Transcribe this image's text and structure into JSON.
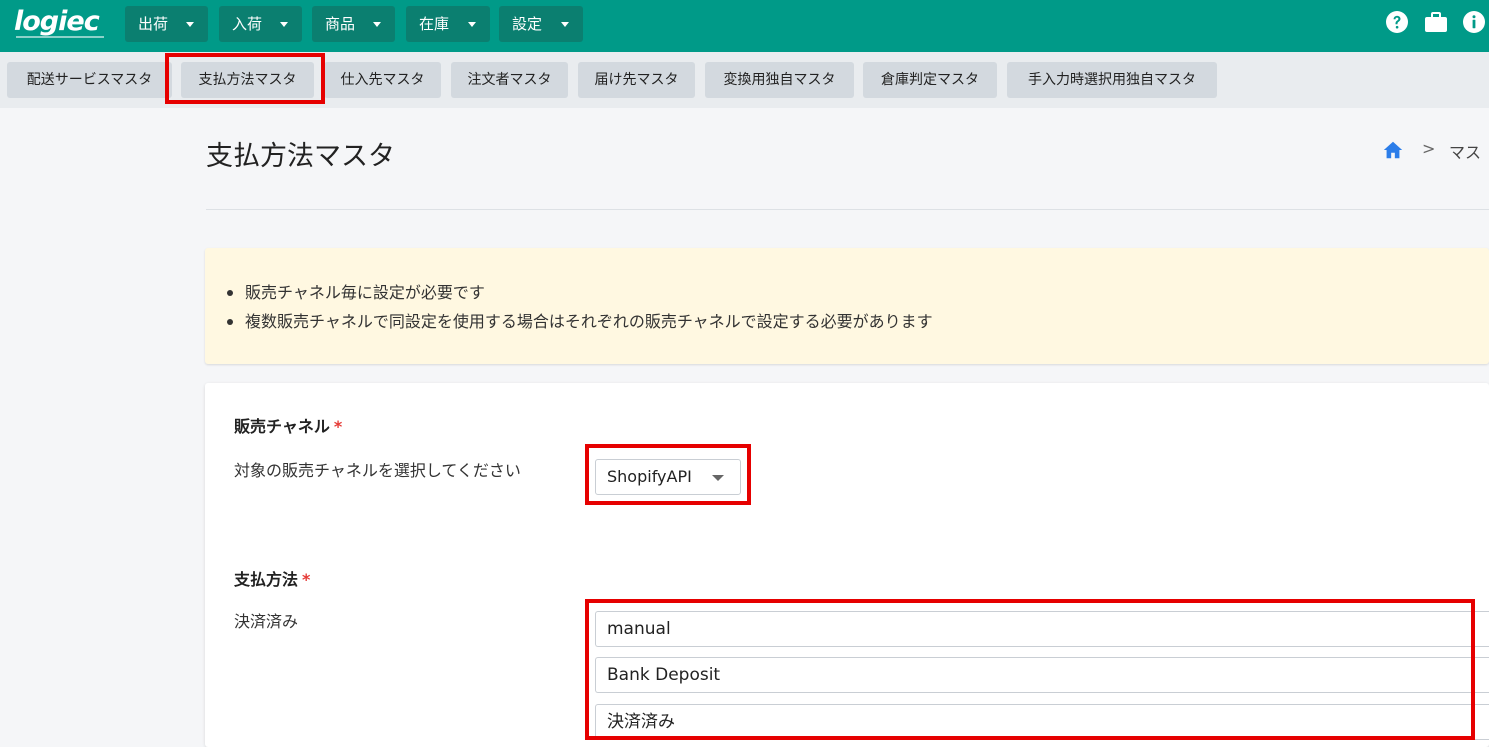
{
  "app": {
    "logo": "logiec"
  },
  "topnav": {
    "menus": [
      {
        "label": "出荷"
      },
      {
        "label": "入荷"
      },
      {
        "label": "商品"
      },
      {
        "label": "在庫"
      },
      {
        "label": "設定"
      }
    ],
    "icons": [
      "help-icon",
      "briefcase-icon",
      "info-icon"
    ]
  },
  "subnav": {
    "tabs": [
      {
        "label": "配送サービスマスタ"
      },
      {
        "label": "支払方法マスタ"
      },
      {
        "label": "仕入先マスタ"
      },
      {
        "label": "注文者マスタ"
      },
      {
        "label": "届け先マスタ"
      },
      {
        "label": "変換用独自マスタ"
      },
      {
        "label": "倉庫判定マスタ"
      },
      {
        "label": "手入力時選択用独自マスタ"
      }
    ],
    "active_index": 1
  },
  "page": {
    "title": "支払方法マスタ",
    "breadcrumb": {
      "separator": ">",
      "current": "マス"
    }
  },
  "notice": {
    "items": [
      "販売チャネル毎に設定が必要です",
      "複数販売チャネルで同設定を使用する場合はそれぞれの販売チャネルで設定する必要があります"
    ]
  },
  "form": {
    "channel": {
      "label": "販売チャネル",
      "required_mark": "*",
      "description": "対象の販売チャネルを選択してください",
      "selected": "ShopifyAPI"
    },
    "payment": {
      "label": "支払方法",
      "required_mark": "*",
      "description": "決済済み",
      "values": [
        "manual",
        "Bank Deposit",
        "決済済み"
      ]
    }
  },
  "colors": {
    "topnav_bg": "#009a88",
    "menu_button_bg": "#0b7f70",
    "highlight_red": "#e60000",
    "notice_bg": "#fff8e1",
    "required": "#e53935"
  }
}
